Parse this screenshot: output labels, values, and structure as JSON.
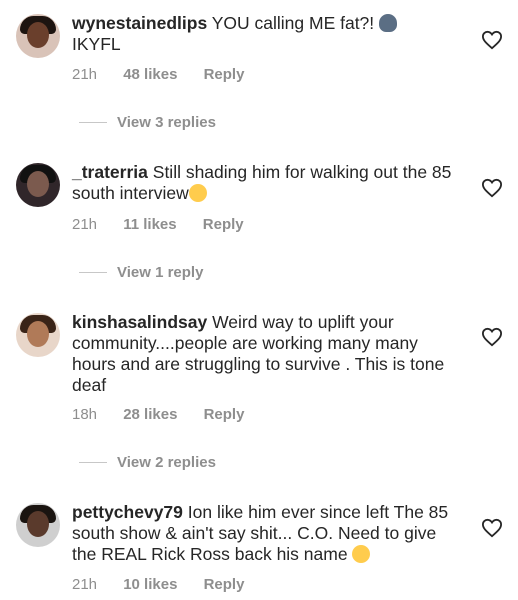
{
  "comments": [
    {
      "username": "wynestainedlips",
      "text": "YOU calling ME fat?!",
      "text_tail": "IKYFL",
      "emoji": "speaking-head",
      "time": "21h",
      "likes": "48 likes",
      "reply": "Reply",
      "view_replies": "View 3 replies"
    },
    {
      "username": "_traterria",
      "text": "Still shading him for walking out the 85 south interview",
      "emoji": "pensive-face",
      "time": "21h",
      "likes": "11 likes",
      "reply": "Reply",
      "view_replies": "View 1 reply"
    },
    {
      "username": "kinshasalindsay",
      "text": "Weird way to uplift your community....people are working many many hours and are struggling to survive . This is tone deaf",
      "time": "18h",
      "likes": "28 likes",
      "reply": "Reply",
      "view_replies": "View 2 replies"
    },
    {
      "username": "pettychevy79",
      "text": "Ion like him ever since left The 85 south show & ain't say shit... C.O. Need to give the REAL Rick Ross back his name",
      "emoji": "pensive-face",
      "time": "21h",
      "likes": "10 likes",
      "reply": "Reply"
    }
  ],
  "icons": {
    "like": "heart-outline-icon"
  }
}
